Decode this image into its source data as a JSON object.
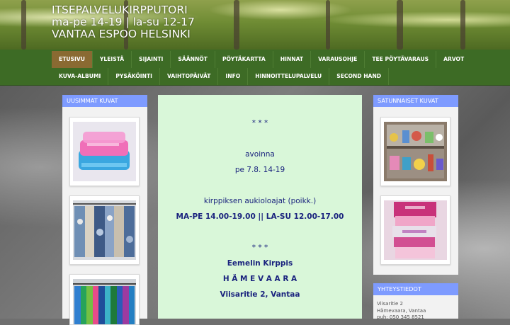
{
  "header": {
    "title_lines": [
      "ITSEPALVELUKIRPPUTORI",
      "ma-pe 14-19 | la-su 12-17",
      "VANTAA ESPOO HELSINKI"
    ]
  },
  "nav": {
    "row1": [
      "ETUSIVU",
      "YLEISTÄ",
      "SIJAINTI",
      "SÄÄNNÖT",
      "PÖYTÄKARTTA",
      "HINNAT",
      "VARAUSOHJE",
      "TEE PÖYTÄVARAUS",
      "ARVOT"
    ],
    "row2": [
      "KUVA-ALBUMI",
      "PYSÄKÖINTI",
      "VAIHTOPÄIVÄT",
      "INFO",
      "HINNOITTELUPALVELU",
      "SECOND HAND"
    ],
    "active": "ETUSIVU"
  },
  "left_sidebar": {
    "title": "UUSIMMAT KUVAT"
  },
  "right_sidebar": {
    "title": "SATUNNAISET KUVAT",
    "contact_title": "YHTEYSTIEDOT",
    "contact_lines": [
      "Viisaritie 2",
      "Hämevaara, Vantaa",
      "puh: 050 345 8521"
    ]
  },
  "main": {
    "stars1": "* * *",
    "line_open": "avoinna",
    "line_date": "pe 7.8. 14-19",
    "line_hours_label": "kirppiksen aukioloajat (poikk.)",
    "line_hours": "MA-PE 14.00-19.00 || LA-SU 12.00-17.00",
    "stars2": "* * *",
    "shop_name": "Eemelin Kirppis",
    "area": "H Ä M E V A A R A",
    "address": "Viisaritie 2, Vantaa"
  },
  "colors": {
    "nav_bg": "#3d6b25",
    "nav_active": "#8a6a32",
    "widget_title_bg": "#7e9bff",
    "main_bg": "#d9f7d9",
    "main_text": "#1a237e"
  }
}
